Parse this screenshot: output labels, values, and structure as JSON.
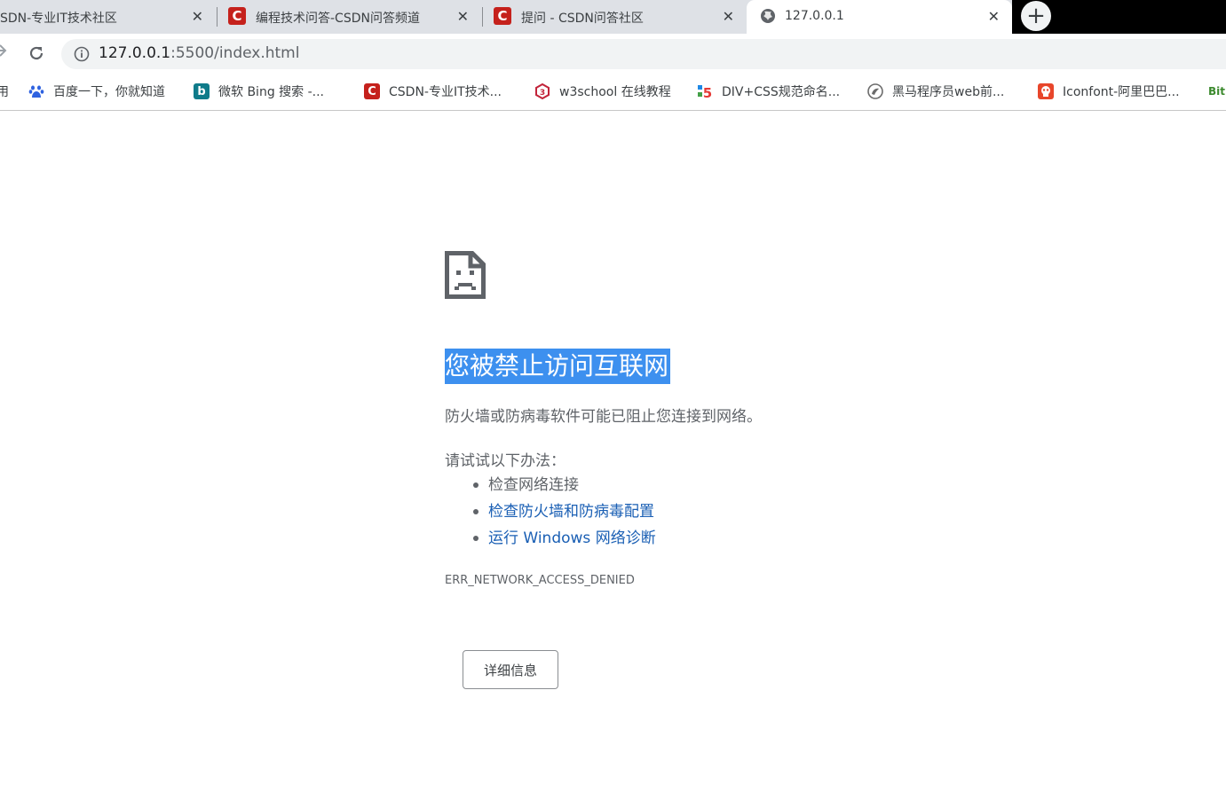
{
  "tabs": [
    {
      "title": "SDN-专业IT技术社区",
      "favicon": "csdn-icon"
    },
    {
      "title": "编程技术问答-CSDN问答频道",
      "favicon": "csdn-icon"
    },
    {
      "title": "提问 - CSDN问答社区",
      "favicon": "csdn-icon"
    },
    {
      "title": "127.0.0.1",
      "favicon": "globe-icon",
      "active": true
    }
  ],
  "tab_close_glyph": "✕",
  "new_tab_glyph": "+",
  "address_bar": {
    "host": "127.0.0.1",
    "path": ":5500/index.html"
  },
  "bookmarks": [
    {
      "label": "用",
      "icon": "apps-icon"
    },
    {
      "label": "百度一下，你就知道",
      "icon": "baidu-icon"
    },
    {
      "label": "微软 Bing 搜索 -...",
      "icon": "bing-icon"
    },
    {
      "label": "CSDN-专业IT技术...",
      "icon": "csdn-icon"
    },
    {
      "label": "w3school 在线教程",
      "icon": "w3school-icon"
    },
    {
      "label": "DIV+CSS规范命名...",
      "icon": "html5-icon"
    },
    {
      "label": "黑马程序员web前...",
      "icon": "heima-icon"
    },
    {
      "label": "Iconfont-阿里巴巴...",
      "icon": "iconfont-icon"
    },
    {
      "label": "Bit",
      "icon": "bitbucket-icon"
    }
  ],
  "error": {
    "title": "您被禁止访问互联网",
    "description": "防火墙或防病毒软件可能已阻止您连接到网络。",
    "try_label": "请试试以下办法：",
    "suggestions": [
      {
        "text": "检查网络连接",
        "link": false
      },
      {
        "text": "检查防火墙和防病毒配置",
        "link": true
      },
      {
        "text": "运行 Windows 网络诊断",
        "link": true
      }
    ],
    "code": "ERR_NETWORK_ACCESS_DENIED",
    "details_button": "详细信息"
  },
  "colors": {
    "tabstrip": "#dee1e6",
    "csdn_red": "#c5211c",
    "title_highlight": "#3d90ef",
    "link_blue": "#1a5fb4",
    "text_grey": "#5f6368"
  }
}
